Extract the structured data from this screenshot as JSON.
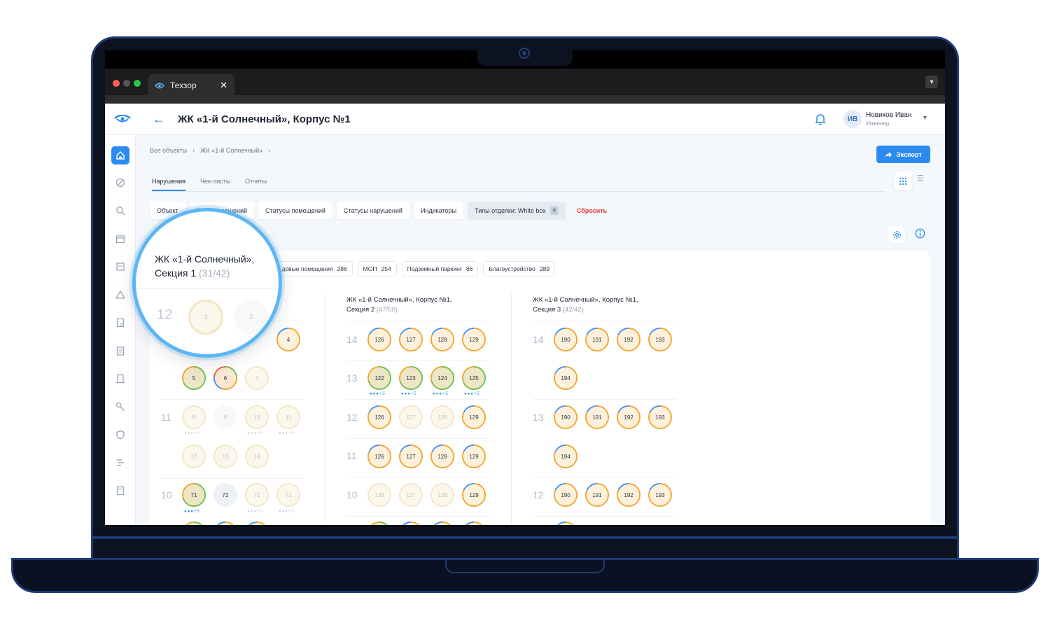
{
  "browser": {
    "tab_title": "Техзор",
    "menu_icon": "chevron-down-icon"
  },
  "header": {
    "title": "ЖК «1-й Солнечный», Корпус №1",
    "user_initials": "ИВ",
    "user_name": "Новиков Иван",
    "user_role": "Инженер"
  },
  "breadcrumb": [
    "Все объекты",
    "ЖК «1-й Солнечный»"
  ],
  "export_label": "Экспорт",
  "tabs": [
    "Нарушения",
    "Чек-листы",
    "Отчеты"
  ],
  "filters": [
    "Объект",
    "Типы помещений",
    "Статусы помещений",
    "Статусы нарушений",
    "Индикаторы",
    "Типы отделки: White box"
  ],
  "reset_label": "Сбросить",
  "categories": [
    {
      "label": "…довые помещения",
      "count": "286"
    },
    {
      "label": "МОП",
      "count": "254"
    },
    {
      "label": "Подземный паркинг",
      "count": "86"
    },
    {
      "label": "Благоустройство",
      "count": "289"
    }
  ],
  "sections": [
    {
      "name": "ЖК «1-й Солнечный»,",
      "name2": "Секция 1",
      "count": "(31/42)"
    },
    {
      "name": "ЖК «1-й Солнечный», Корпус №1,",
      "name2": "Секция 2",
      "count": "(47/50)"
    },
    {
      "name": "ЖК «1-й Солнечный», Корпус №1,",
      "name2": "Секция 3",
      "count": "(42/42)"
    }
  ],
  "magnifier": {
    "floor": "12",
    "units": [
      "1",
      "2"
    ]
  },
  "colors": {
    "accent": "#2b8bf0",
    "reset": "#e53935",
    "ring_orange": "#f0a42a",
    "ring_green": "#6abf45"
  }
}
